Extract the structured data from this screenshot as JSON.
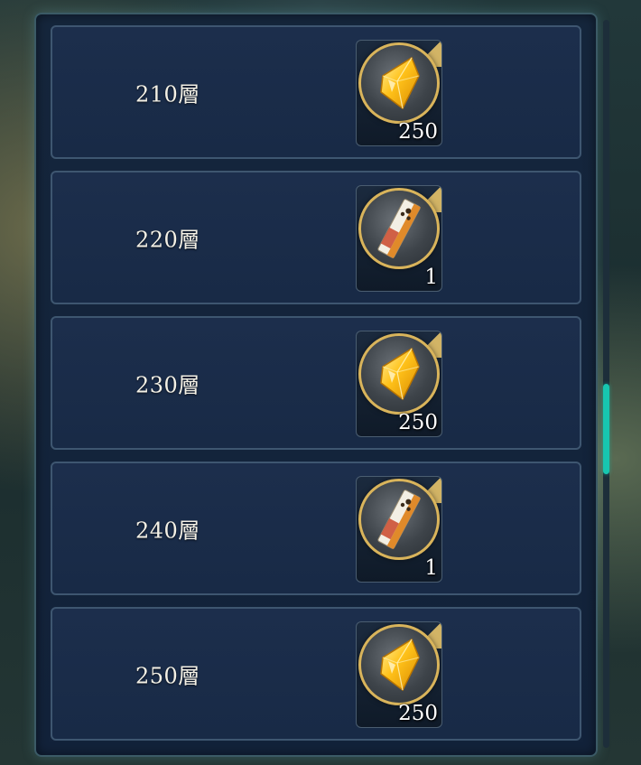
{
  "rewards_list": {
    "rows": [
      {
        "floor_label": "210層",
        "item_icon": "gem-icon",
        "quantity": "250"
      },
      {
        "floor_label": "220層",
        "item_icon": "scroll-ticket-icon",
        "quantity": "1"
      },
      {
        "floor_label": "230層",
        "item_icon": "gem-icon",
        "quantity": "250"
      },
      {
        "floor_label": "240層",
        "item_icon": "scroll-ticket-icon",
        "quantity": "1"
      },
      {
        "floor_label": "250層",
        "item_icon": "gem-icon",
        "quantity": "250"
      }
    ]
  },
  "scrollbar": {
    "thumb_color": "#17c6b0"
  },
  "colors": {
    "panel_bg": "#15263c",
    "row_bg": "#1c2e4c",
    "row_border": "#3e5670",
    "gold_frame": "#d9b45b"
  }
}
